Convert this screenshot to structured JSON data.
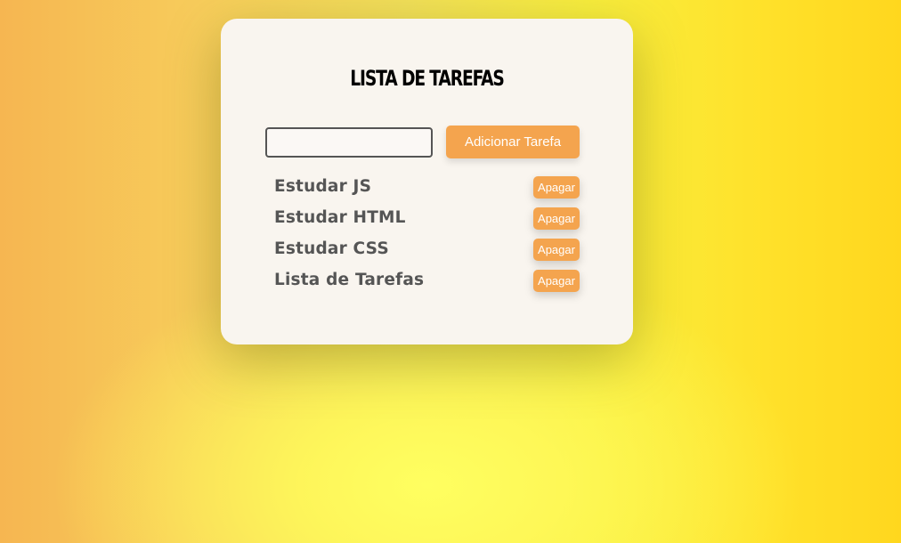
{
  "header": {
    "title": "Lista de Tarefas"
  },
  "form": {
    "input_value": "",
    "add_button_label": "Adicionar Tarefa"
  },
  "tasks": [
    {
      "text": "Estudar JS",
      "delete_label": "Apagar"
    },
    {
      "text": "Estudar HTML",
      "delete_label": "Apagar"
    },
    {
      "text": "Estudar CSS",
      "delete_label": "Apagar"
    },
    {
      "text": "Lista de Tarefas",
      "delete_label": "Apagar"
    }
  ],
  "colors": {
    "accent": "#f4a44e",
    "card_background": "#f9f5ef",
    "task_text": "#555555"
  }
}
